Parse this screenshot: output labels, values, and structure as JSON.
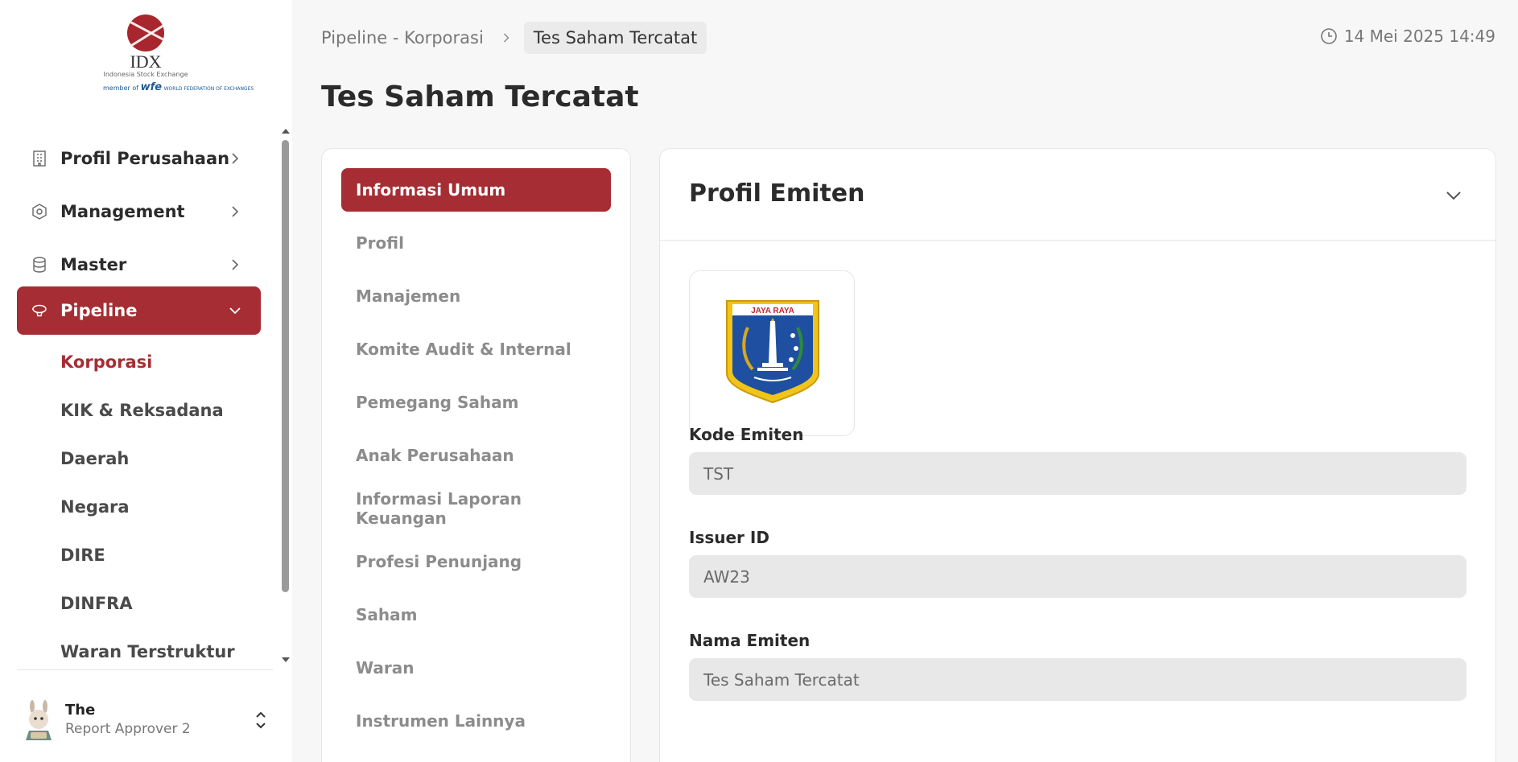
{
  "sidebar": {
    "logo": {
      "name": "IDX",
      "sub": "Indonesia Stock Exchange",
      "wfe": "WORLD FEDERATION OF EXCHANGES"
    },
    "items": [
      {
        "label": "Profil Perusahaan",
        "icon": "building-icon"
      },
      {
        "label": "Management",
        "icon": "settings-hexagon-icon"
      },
      {
        "label": "Master",
        "icon": "database-icon"
      },
      {
        "label": "Pipeline",
        "icon": "blimp-icon"
      }
    ],
    "sub_items": [
      "Korporasi",
      "KIK & Reksadana",
      "Daerah",
      "Negara",
      "DIRE",
      "DINFRA",
      "Waran Terstruktur"
    ],
    "active_sub": "Korporasi",
    "accent": "#a52d33"
  },
  "user": {
    "name": "The",
    "role": "Report Approver 2"
  },
  "breadcrumb": {
    "parent": "Pipeline - Korporasi",
    "current": "Tes Saham Tercatat"
  },
  "datetime": "14 Mei 2025 14:49",
  "page_title": "Tes Saham Tercatat",
  "tabs": [
    "Informasi Umum",
    "Profil",
    "Manajemen",
    "Komite Audit & Internal",
    "Pemegang Saham",
    "Anak Perusahaan",
    "Informasi Laporan Keuangan",
    "Profesi Penunjang",
    "Saham",
    "Waran",
    "Instrumen Lainnya"
  ],
  "card": {
    "title": "Profil Emiten",
    "emblem_text": "JAYA RAYA",
    "fields": [
      {
        "label": "Kode Emiten",
        "value": "TST"
      },
      {
        "label": "Issuer ID",
        "value": "AW23"
      },
      {
        "label": "Nama Emiten",
        "value": "Tes Saham Tercatat"
      }
    ]
  }
}
